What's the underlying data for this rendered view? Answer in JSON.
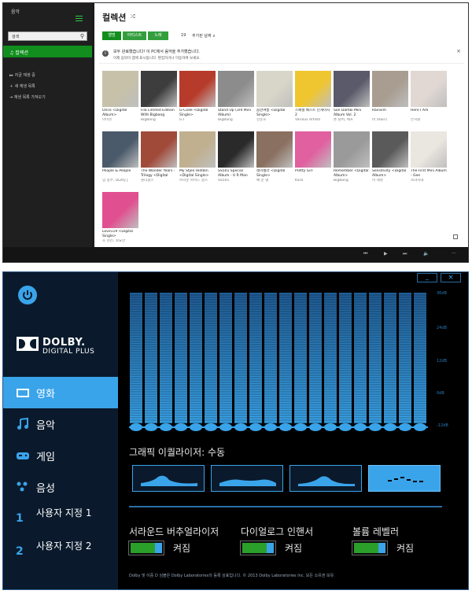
{
  "music_app": {
    "app_title": "음악",
    "search_placeholder": "검색",
    "nav": {
      "active": "컬렉션",
      "items": [
        "지금 재생 중",
        "새 재생 목록",
        "재생 목록 가져오기"
      ]
    },
    "title": "컬렉션",
    "filter_tabs": [
      "앨범",
      "아티스트",
      "노래"
    ],
    "album_count": "19",
    "sort_label": "추가된 날짜 ∨",
    "notice": {
      "line1": "모두 완료했습니다! 이 PC에서 음악을 추가했습니다.",
      "line2": "이제 음악이 앱에 표시됩니다. 편집하거나 이동하여 보세요."
    },
    "albums": [
      {
        "title": "Once <Digital Album>",
        "artist": "아이유",
        "color": "#c6c1a8"
      },
      {
        "title": "Fila Limited Edition With Bigbang",
        "artist": "BigBang",
        "color": "#3d3d3d"
      },
      {
        "title": "G-Code <Digital Single>",
        "artist": "G.I",
        "color": "#b73b2a"
      },
      {
        "title": "Stand Up (3rd Mini Album)",
        "artist": "BigBang",
        "color": "#8c8c8c"
      },
      {
        "title": "봄한여름 <Digital Single>",
        "artist": "신순호",
        "color": "#d8d6c9"
      },
      {
        "title": "스페셜 베스트 인게이지 2",
        "artist": "Various Artists",
        "color": "#f0c630"
      },
      {
        "title": "Son Dambi Mini Album Vol. 2",
        "artist": "손 담비, 애프",
        "color": "#5a5a6a"
      },
      {
        "title": "Rainism",
        "artist": "비 (Rain)",
        "color": "#a89d90"
      },
      {
        "title": "Here I Am",
        "artist": "은지원",
        "color": "#e1d8d3"
      },
      {
        "title": "People & People",
        "artist": "임 종주, Dusty J",
        "color": "#4a5a6a"
      },
      {
        "title": "The Wonder Years - Trilogy <Digital",
        "artist": "원더걸스",
        "color": "#a04a3a"
      },
      {
        "title": "My Style Hidden <Digital Single>",
        "artist": "브라운 아이드 걸스",
        "color": "#c0b090"
      },
      {
        "title": "SS501 Special Album - U R Man",
        "artist": "SS501",
        "color": "#2a2a2a"
      },
      {
        "title": "레이첼라 <Digital Single>",
        "artist": "예 운 별",
        "color": "#8a7060"
      },
      {
        "title": "Pretty Girl",
        "artist": "Kara",
        "color": "#e060a0"
      },
      {
        "title": "Remember <Digital Album>",
        "artist": "BigBang",
        "color": "#9a9a9a"
      },
      {
        "title": "Sensitivity <Digital Album>",
        "artist": "이 세영",
        "color": "#5a5a5a"
      },
      {
        "title": "The First Mini Album - Gee",
        "artist": "소녀시대",
        "color": "#eae6e0"
      },
      {
        "title": "Love119 <Digital Single>",
        "artist": "조 현진, 최요한",
        "color": "#e05090"
      }
    ]
  },
  "dolby": {
    "logo_line1": "DOLBY.",
    "logo_line2": "DIGITAL PLUS",
    "nav": [
      {
        "label": "영화",
        "icon": "movie-icon",
        "active": true
      },
      {
        "label": "음악",
        "icon": "music-note-icon",
        "active": false
      },
      {
        "label": "게임",
        "icon": "gamepad-icon",
        "active": false
      },
      {
        "label": "음성",
        "icon": "voice-icon",
        "active": false
      },
      {
        "label": "사용자 지정 1",
        "icon": "custom-1-icon",
        "active": false
      },
      {
        "label": "사용자 지정 2",
        "icon": "custom-2-icon",
        "active": false
      }
    ],
    "db_labels": [
      "36dB",
      "24dB",
      "12dB",
      "0dB",
      "-12dB"
    ],
    "eq_bands": 20,
    "eq_label": "그래픽 이퀄라이저: 수동",
    "presets": [
      "open-preset",
      "rich-preset",
      "focused-preset",
      "manual-preset"
    ],
    "active_preset": 3,
    "toggles": [
      {
        "label": "서라운드 버추얼라이저",
        "state": "켜짐",
        "on": true
      },
      {
        "label": "다이얼로그 인핸서",
        "state": "켜짐",
        "on": true
      },
      {
        "label": "볼륨 레벨러",
        "state": "켜짐",
        "on": true
      }
    ],
    "footer": "Dolby 및 이중 D 심볼은 Dolby Laboratories의 등록 상표입니다. © 2013 Dolby Laboratories Inc. 모든 소유권 보유.",
    "accent": "#3aa4ea"
  }
}
